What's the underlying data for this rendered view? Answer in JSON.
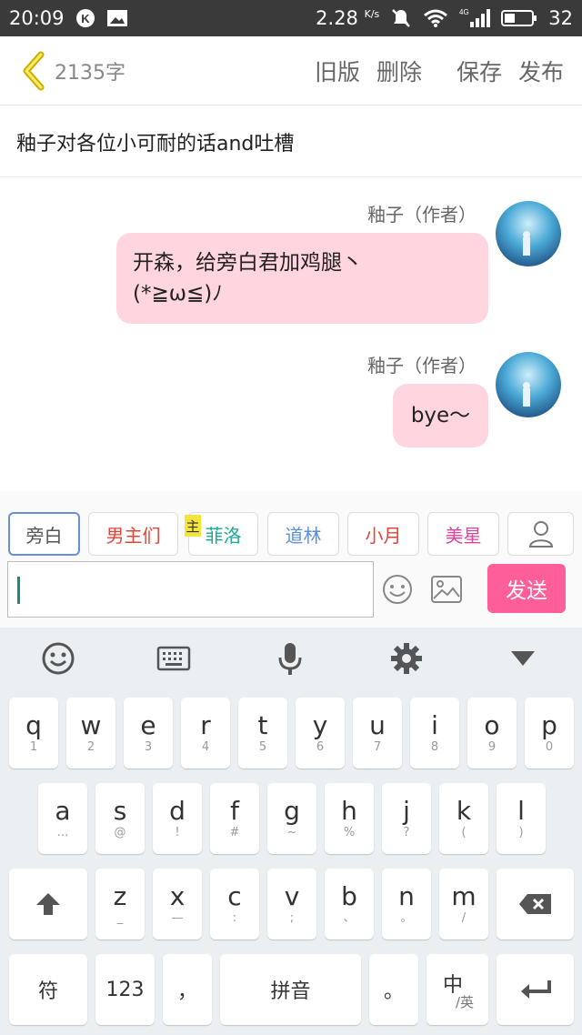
{
  "status_bar": {
    "time": "20:09",
    "speed": "2.28",
    "speed_unit": "K/s",
    "signal_label": "4G",
    "battery": "32"
  },
  "header": {
    "word_count": "2135字",
    "actions": [
      "旧版",
      "删除",
      "保存",
      "发布"
    ]
  },
  "title": "釉子对各位小可耐的话and吐槽",
  "messages": [
    {
      "author": "釉子（作者）",
      "text_line1": "开森，给旁白君加鸡腿丶",
      "text_line2": "(*≧ω≦)ﾉ"
    },
    {
      "author": "釉子（作者）",
      "text_line1": "bye～"
    }
  ],
  "roles": [
    {
      "label": "旁白",
      "color": "#555555"
    },
    {
      "label": "男主们",
      "color": "#e0453a"
    },
    {
      "label": "菲洛",
      "color": "#1aa89a"
    },
    {
      "label": "道林",
      "color": "#5b8fe0"
    },
    {
      "label": "小月",
      "color": "#e0453a"
    },
    {
      "label": "美星",
      "color": "#e040a0"
    }
  ],
  "role_badge": "主",
  "send_label": "发送",
  "keyboard": {
    "row1": [
      [
        "q",
        "1"
      ],
      [
        "w",
        "2"
      ],
      [
        "e",
        "3"
      ],
      [
        "r",
        "4"
      ],
      [
        "t",
        "5"
      ],
      [
        "y",
        "6"
      ],
      [
        "u",
        "7"
      ],
      [
        "i",
        "8"
      ],
      [
        "o",
        "9"
      ],
      [
        "p",
        "0"
      ]
    ],
    "row2": [
      [
        "a",
        "…"
      ],
      [
        "s",
        "@"
      ],
      [
        "d",
        "!"
      ],
      [
        "f",
        "#"
      ],
      [
        "g",
        "~"
      ],
      [
        "h",
        "%"
      ],
      [
        "j",
        "?"
      ],
      [
        "k",
        "("
      ],
      [
        "l",
        ")"
      ]
    ],
    "row3": [
      [
        "z",
        "_"
      ],
      [
        "x",
        "—"
      ],
      [
        "c",
        ":"
      ],
      [
        "v",
        ";"
      ],
      [
        "b",
        "、"
      ],
      [
        "n",
        "。"
      ],
      [
        "m",
        "/"
      ]
    ],
    "symbol_key": "符",
    "num_key": "123",
    "comma_key": "，",
    "space_key": "拼音",
    "period_key": "。",
    "lang_key_main": "中",
    "lang_key_sub": "/英"
  },
  "colors": {
    "bubble": "#ffd6e0",
    "send": "#ff5f98",
    "status_bar": "#3a3a3a"
  }
}
